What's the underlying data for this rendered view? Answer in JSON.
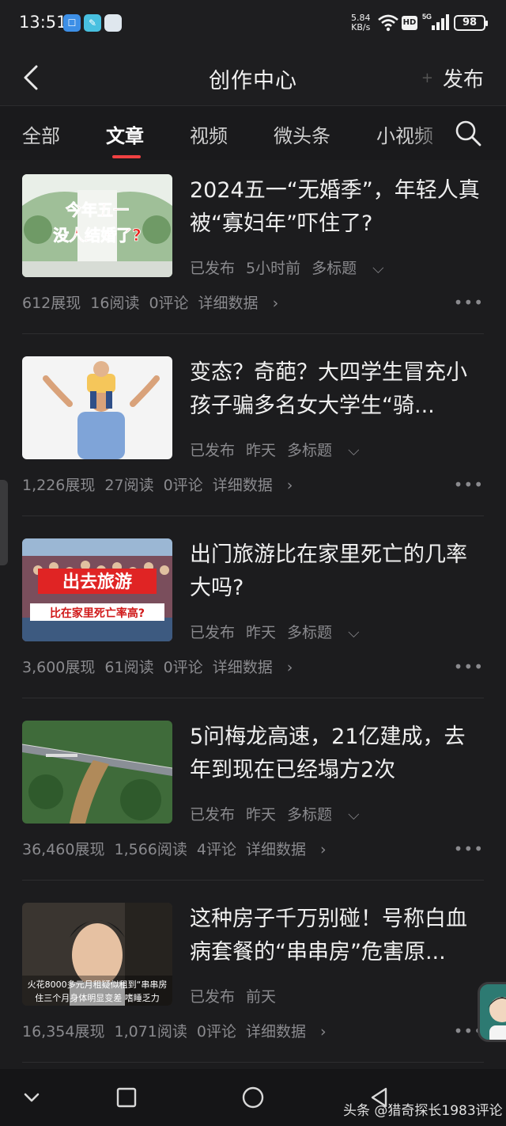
{
  "status_bar": {
    "time": "13:51",
    "net_speed_value": "5.84",
    "net_speed_unit": "KB/s",
    "hd_badge": "HD",
    "signal_label": "5G",
    "battery": "98"
  },
  "header": {
    "title": "创作中心",
    "publish_label": "发布"
  },
  "tabs": [
    {
      "label": "全部"
    },
    {
      "label": "文章"
    },
    {
      "label": "视频"
    },
    {
      "label": "微头条"
    },
    {
      "label": "小视频"
    }
  ],
  "active_tab": "文章",
  "articles": [
    {
      "title": "2024五一“无婚季”，年轻人真被“寡妇年”吓住了?",
      "status": "已发布",
      "time": "5小时前",
      "multi_title": "多标题",
      "views": "612展现",
      "reads": "16阅读",
      "comments": "0评论",
      "detail": "详细数据",
      "thumb_text_1": "今年五一",
      "thumb_text_2": "没人结婚了?"
    },
    {
      "title": "变态？奇葩？大四学生冒充小孩子骗多名女大学生“骑...",
      "status": "已发布",
      "time": "昨天",
      "multi_title": "多标题",
      "views": "1,226展现",
      "reads": "27阅读",
      "comments": "0评论",
      "detail": "详细数据"
    },
    {
      "title": "出门旅游比在家里死亡的几率大吗?",
      "status": "已发布",
      "time": "昨天",
      "multi_title": "多标题",
      "views": "3,600展现",
      "reads": "61阅读",
      "comments": "0评论",
      "detail": "详细数据",
      "thumb_text_1": "出去旅游",
      "thumb_text_2": "比在家里死亡率高?"
    },
    {
      "title": "5问梅龙高速，21亿建成，去年到现在已经塌方2次",
      "status": "已发布",
      "time": "昨天",
      "multi_title": "多标题",
      "views": "36,460展现",
      "reads": "1,566阅读",
      "comments": "4评论",
      "detail": "详细数据"
    },
    {
      "title": "这种房子千万别碰！号称白血病套餐的“串串房”危害原...",
      "status": "已发布",
      "time": "前天",
      "multi_title": "",
      "views": "16,354展现",
      "reads": "1,071阅读",
      "comments": "0评论",
      "detail": "详细数据",
      "thumb_text_1": "火花8000多元月租疑似租到“串串房",
      "thumb_text_2": "住三个月身体明显变差 嗜睡乏力"
    }
  ],
  "more_label": "•••",
  "watermark": "头条 @猎奇探长1983评论",
  "colors": {
    "background": "#1c1c1e",
    "accent": "#f04142",
    "secondary_text": "#8a8a8e"
  }
}
